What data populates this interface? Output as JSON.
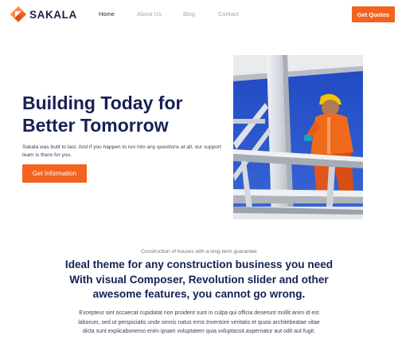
{
  "brand": {
    "name": "SAKALA",
    "accent": "#f4621f",
    "navy": "#172056"
  },
  "nav": {
    "items": [
      {
        "label": "Home",
        "active": true
      },
      {
        "label": "About Us",
        "active": false
      },
      {
        "label": "Blog",
        "active": false
      },
      {
        "label": "Contact",
        "active": false
      }
    ],
    "cta_label": "Get Quotes"
  },
  "hero": {
    "title_line1": "Building Today for",
    "title_line2": "Better Tomorrow",
    "text": "Sakala was built to last. And if you happen to run into any questions at all, our support team is there for you.",
    "button_label": "Get Information",
    "image": "construction-worker-on-steel-frame"
  },
  "about": {
    "subtitle": "Construction of houses with a long-term guarantee",
    "heading": "Ideal theme for any construction business you need With visual Composer, Revolution slider and other awesome features, you cannot go wrong.",
    "body": "Excepteur sint occaecat cupidatat non proident sunt in culpa qui officia deserunt mollit anim id est laborum, sed ut perspiciatis unde omnis natus error.Inventore veritatis et quasi architebeatae vitae dicta sunt explicabonemo enim ipsam voluptatem quia voluptassit.aspernatur aut odit aut fugit."
  }
}
